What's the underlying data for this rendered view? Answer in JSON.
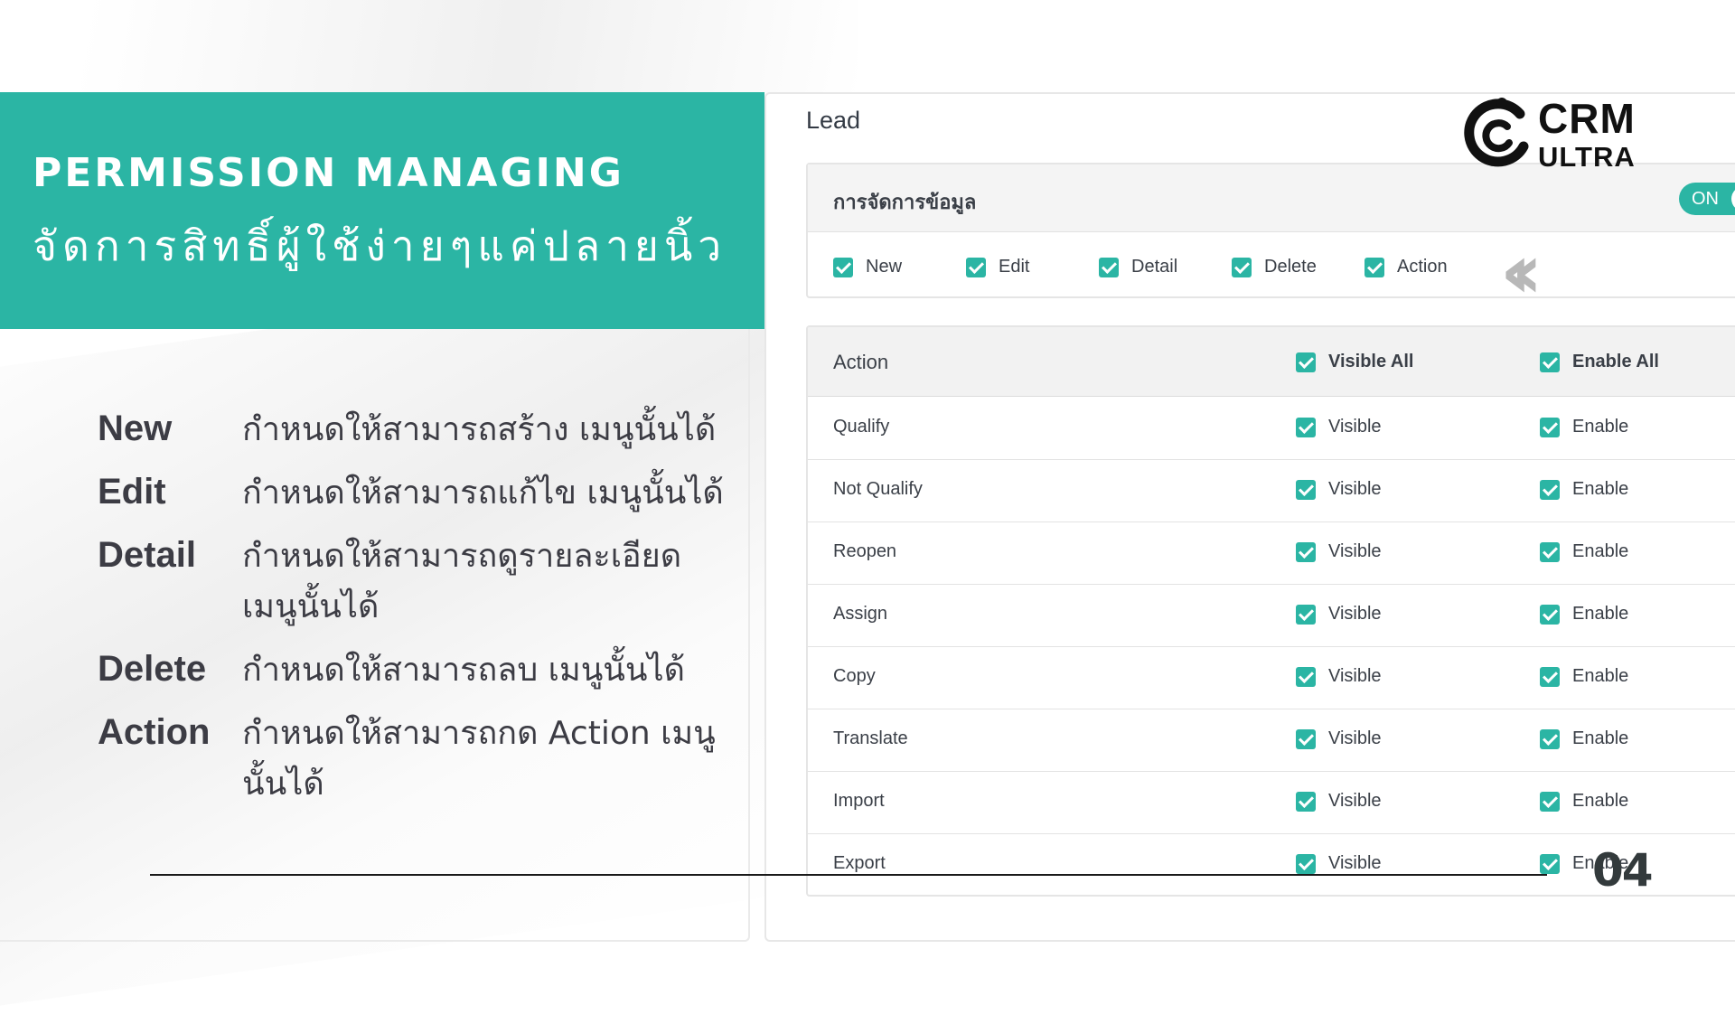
{
  "banner": {
    "title": "PERMISSION MANAGING",
    "subtitle": "จัดการสิทธิ์ผู้ใช้ง่ายๆแค่ปลายนิ้ว",
    "color": "#2bb5a4"
  },
  "legend": [
    {
      "term": "New",
      "desc": "กำหนดให้สามารถสร้าง เมนูนั้นได้"
    },
    {
      "term": "Edit",
      "desc": "กำหนดให้สามารถแก้ไข เมนูนั้นได้"
    },
    {
      "term": "Detail",
      "desc": "กำหนดให้สามารถดูรายละเอียด เมนูนั้นได้"
    },
    {
      "term": "Delete",
      "desc": "กำหนดให้สามารถลบ เมนูนั้นได้"
    },
    {
      "term": "Action",
      "desc": "กำหนดให้สามารถกด Action เมนูนั้นได้"
    }
  ],
  "panel": {
    "title": "Lead",
    "management": {
      "title": "การจัดการข้อมูล",
      "toggle_label": "ON",
      "toggle_on": true,
      "permissions": [
        {
          "label": "New",
          "checked": true
        },
        {
          "label": "Edit",
          "checked": true
        },
        {
          "label": "Detail",
          "checked": true
        },
        {
          "label": "Delete",
          "checked": true
        },
        {
          "label": "Action",
          "checked": true
        }
      ]
    },
    "table": {
      "header": {
        "action": "Action",
        "visible_all": "Visible All",
        "enable_all": "Enable All"
      },
      "rows": [
        {
          "action": "Qualify",
          "visible": "Visible",
          "enable": "Enable"
        },
        {
          "action": "Not Qualify",
          "visible": "Visible",
          "enable": "Enable"
        },
        {
          "action": "Reopen",
          "visible": "Visible",
          "enable": "Enable"
        },
        {
          "action": "Assign",
          "visible": "Visible",
          "enable": "Enable"
        },
        {
          "action": "Copy",
          "visible": "Visible",
          "enable": "Enable"
        },
        {
          "action": "Translate",
          "visible": "Visible",
          "enable": "Enable"
        },
        {
          "action": "Import",
          "visible": "Visible",
          "enable": "Enable"
        },
        {
          "action": "Export",
          "visible": "Visible",
          "enable": "Enable"
        }
      ]
    }
  },
  "logo": {
    "line1": "CRM",
    "line2": "ULTRA"
  },
  "page_number": "04",
  "icons": {
    "chevrons": "double-chevron-left-icon",
    "checkbox": "checkbox-checked-icon"
  }
}
